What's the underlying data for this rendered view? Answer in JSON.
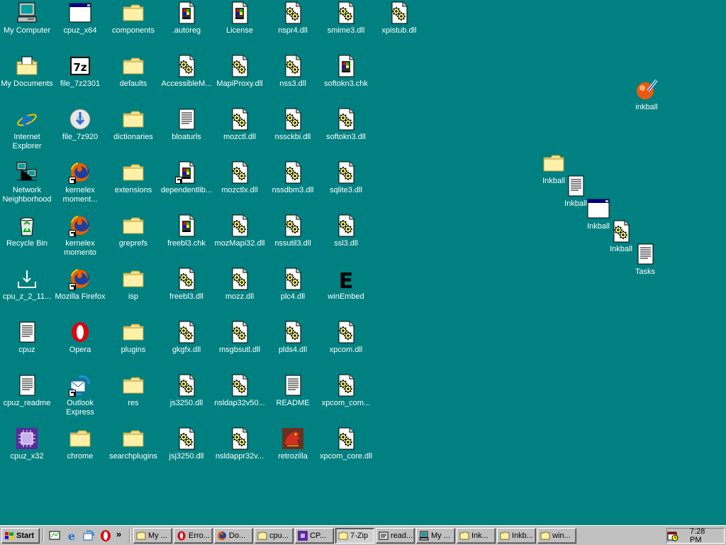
{
  "desktop_icons": [
    {
      "label": "My Computer",
      "type": "computer"
    },
    {
      "label": "My Documents",
      "type": "mydocs"
    },
    {
      "label": "Internet Explorer",
      "type": "ie"
    },
    {
      "label": "Network Neighborhood",
      "type": "network"
    },
    {
      "label": "Recycle Bin",
      "type": "recycle"
    },
    {
      "label": "cpu_z_2_11...",
      "type": "download"
    },
    {
      "label": "cpuz",
      "type": "textdoc"
    },
    {
      "label": "cpuz_readme",
      "type": "textdoc"
    },
    {
      "label": "cpuz_x32",
      "type": "chip"
    },
    {
      "label": "cpuz_x64",
      "type": "window"
    },
    {
      "label": "file_7z2301",
      "type": "sevenzip"
    },
    {
      "label": "file_7z920",
      "type": "installer"
    },
    {
      "label": "kernelex moment...",
      "type": "firefox"
    },
    {
      "label": "kernelex momento",
      "type": "firefox"
    },
    {
      "label": "Mozilla Firefox",
      "type": "firefox"
    },
    {
      "label": "Opera",
      "type": "opera"
    },
    {
      "label": "Outlook Express",
      "type": "outlook"
    },
    {
      "label": "chrome",
      "type": "folder"
    },
    {
      "label": "components",
      "type": "folder"
    },
    {
      "label": "defaults",
      "type": "folder"
    },
    {
      "label": "dictionaries",
      "type": "folder"
    },
    {
      "label": "extensions",
      "type": "folder"
    },
    {
      "label": "greprefs",
      "type": "folder"
    },
    {
      "label": "isp",
      "type": "folder"
    },
    {
      "label": "plugins",
      "type": "folder"
    },
    {
      "label": "res",
      "type": "folder"
    },
    {
      "label": "searchplugins",
      "type": "folder"
    },
    {
      "label": ".autoreg",
      "type": "sysfile"
    },
    {
      "label": "AccessibleM...",
      "type": "dll"
    },
    {
      "label": "bloaturls",
      "type": "textdoc"
    },
    {
      "label": "dependentlib...",
      "type": "sysfile"
    },
    {
      "label": "freebl3.chk",
      "type": "sysfile"
    },
    {
      "label": "freebl3.dll",
      "type": "dll"
    },
    {
      "label": "gkgfx.dll",
      "type": "dll"
    },
    {
      "label": "js3250.dll",
      "type": "dll"
    },
    {
      "label": "jsj3250.dll",
      "type": "dll"
    },
    {
      "label": "License",
      "type": "sysfile"
    },
    {
      "label": "MapiProxy.dll",
      "type": "dll"
    },
    {
      "label": "mozctl.dll",
      "type": "dll"
    },
    {
      "label": "mozctlx.dll",
      "type": "dll"
    },
    {
      "label": "mozMapi32.dll",
      "type": "dll"
    },
    {
      "label": "mozz.dll",
      "type": "dll"
    },
    {
      "label": "msgbsutl.dll",
      "type": "dll"
    },
    {
      "label": "nsldap32v50...",
      "type": "dll"
    },
    {
      "label": "nsldappr32v...",
      "type": "dll"
    },
    {
      "label": "nspr4.dll",
      "type": "dll"
    },
    {
      "label": "nss3.dll",
      "type": "dll"
    },
    {
      "label": "nssckbi.dll",
      "type": "dll"
    },
    {
      "label": "nssdbm3.dll",
      "type": "dll"
    },
    {
      "label": "nssutil3.dll",
      "type": "dll"
    },
    {
      "label": "plc4.dll",
      "type": "dll"
    },
    {
      "label": "plds4.dll",
      "type": "dll"
    },
    {
      "label": "README",
      "type": "textdoc"
    },
    {
      "label": "retrozilla",
      "type": "retrozilla"
    },
    {
      "label": "smime3.dll",
      "type": "dll"
    },
    {
      "label": "softokn3.chk",
      "type": "sysfile"
    },
    {
      "label": "softokn3.dll",
      "type": "dll"
    },
    {
      "label": "sqlite3.dll",
      "type": "dll"
    },
    {
      "label": "ssl3.dll",
      "type": "dll"
    },
    {
      "label": "winEmbed",
      "type": "letter-e"
    },
    {
      "label": "xpcom.dll",
      "type": "dll"
    },
    {
      "label": "xpcom_com...",
      "type": "dll"
    },
    {
      "label": "xpcom_core.dll",
      "type": "dll"
    },
    {
      "label": "xpistub.dll",
      "type": "dll"
    },
    {
      "label": "inkball",
      "type": "inkball"
    },
    {
      "label": "Inkball",
      "type": "folder"
    },
    {
      "label": "Inkball",
      "type": "textdoc"
    },
    {
      "label": "Inkball",
      "type": "window"
    },
    {
      "label": "Inkball",
      "type": "dll"
    },
    {
      "label": "Tasks",
      "type": "textdoc"
    }
  ],
  "taskbar": {
    "start_label": "Start",
    "quick_launch": [
      {
        "icon": "show-desktop-icon"
      },
      {
        "icon": "ie-icon"
      },
      {
        "icon": "outlook-icon"
      },
      {
        "icon": "opera-icon"
      }
    ],
    "overflow_label": "»",
    "buttons": [
      {
        "label": "My ...",
        "icon": "folder"
      },
      {
        "label": "Erro...",
        "icon": "opera"
      },
      {
        "label": "Do...",
        "icon": "firefox"
      },
      {
        "label": "cpu...",
        "icon": "folder"
      },
      {
        "label": "CP...",
        "icon": "chip"
      },
      {
        "label": "7-Zip",
        "icon": "folder",
        "pressed": true
      },
      {
        "label": "read...",
        "icon": "tools"
      },
      {
        "label": "My ...",
        "icon": "computer"
      },
      {
        "label": "Ink...",
        "icon": "folder"
      },
      {
        "label": "Inkb...",
        "icon": "folder"
      },
      {
        "label": "win...",
        "icon": "folder"
      }
    ],
    "clock": "7:28 PM",
    "tray_icon": "scheduler-icon"
  },
  "colors": {
    "desktop": "#008080",
    "taskbar": "#c0c0c0"
  }
}
